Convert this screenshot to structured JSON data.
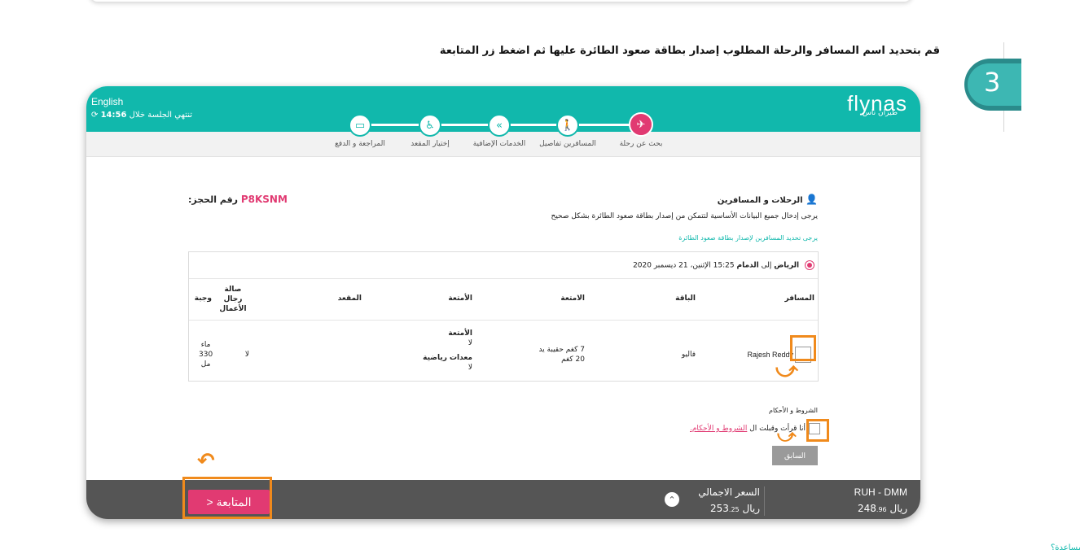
{
  "instruction": "قم بتحديد اسم المسافر والرحلة المطلوب إصدار بطاقة صعود الطائرة عليها ثم اضغط زر المتابعة",
  "step_number": "3",
  "header": {
    "lang_label": "English",
    "session_text": "تنتهي الجلسة خلال",
    "session_time": "14:56",
    "logo": "flynas",
    "logo_sub": "طيران ناس"
  },
  "steps": [
    {
      "label": "بحث عن رحلة",
      "icon": "plane-icon"
    },
    {
      "label": "المسافرين تفاصيل",
      "icon": "traveler-icon"
    },
    {
      "label": "الخدمات الإضافية",
      "icon": "services-icon"
    },
    {
      "label": "إختيار المقعد",
      "icon": "seat-icon"
    },
    {
      "label": "المراجعة و الدفع",
      "icon": "payment-icon"
    }
  ],
  "booking": {
    "label": "رقم الحجز:",
    "code": "P8KSNM"
  },
  "section": {
    "title": "الرحلات و المسافرين",
    "description": "يرجى إدخال جميع البيانات الأساسية لتتمكن من إصدار بطاقة صعود الطائرة بشكل صحيح",
    "note": "يرجى تحديد المسافرين لإصدار بطاقة صعود الطائرة"
  },
  "flight": {
    "from": "الرياض",
    "to_word": "إلى",
    "to": "الدمام",
    "details": "15:25 الإثنين، 21 ديسمبر 2020"
  },
  "table": {
    "headers": {
      "passenger": "المسافر",
      "bundle": "الباقة",
      "baggage": "الامتعة",
      "extras": "الأمتعة",
      "seat": "المقعد",
      "lounge": "صالة رجال الأعمال",
      "meal": "وجبة"
    },
    "row": {
      "passenger": "Rajesh Reddy",
      "bundle": "فاليو",
      "baggage_line1": "7 كغم حقيبة يد",
      "baggage_line2": "20 كغم",
      "extras_title1": "الأمتعة",
      "extras_val1": "لا",
      "extras_title2": "معدات رياضية",
      "extras_val2": "لا",
      "seat": "",
      "lounge": "لا",
      "meal_line1": "ماء",
      "meal_line2": "330",
      "meal_line3": "مل"
    }
  },
  "terms": {
    "label": "الشروط و الأحكام",
    "text": "أنا قرأت وقبلت ال",
    "link": "الشروط و الأحكام."
  },
  "buttons": {
    "previous": "السابق",
    "continue": "المتابعة"
  },
  "footer": {
    "total_label": "السعر الاجمالي",
    "total_value": "253",
    "total_decimals": ".25",
    "currency": "ريال",
    "route": "RUH - DMM",
    "route_value": "248",
    "route_decimals": ".96"
  },
  "help": "مساعدة؟",
  "colors": {
    "teal": "#11b8ac",
    "pink": "#e13a72",
    "orange": "#f08a1c",
    "footer": "#555555"
  }
}
